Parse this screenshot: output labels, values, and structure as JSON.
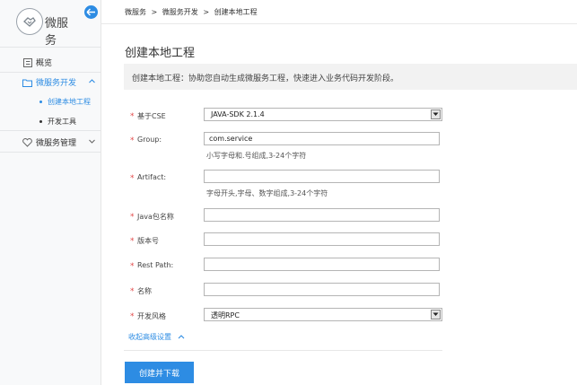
{
  "sidebar": {
    "app_title": "微服务",
    "items": [
      {
        "label": "概览",
        "icon": "list-icon"
      },
      {
        "label": "微服务开发",
        "icon": "folder-icon",
        "active": true,
        "children": [
          {
            "label": "创建本地工程",
            "active": true
          },
          {
            "label": "开发工具"
          }
        ]
      },
      {
        "label": "微服务管理",
        "icon": "heart-icon"
      }
    ]
  },
  "breadcrumb": [
    "微服务",
    ">",
    "微服务开发",
    ">",
    "创建本地工程"
  ],
  "page_title": "创建本地工程",
  "info_text": "创建本地工程：协助您自动生成微服务工程，快速进入业务代码开发阶段。",
  "form": {
    "base_cse": {
      "label": "基于CSE",
      "value": "JAVA-SDK 2.1.4"
    },
    "group": {
      "label": "Group:",
      "value": "com.service",
      "hint": "小写字母和.号组成,3-24个字符"
    },
    "artifact": {
      "label": "Artifact:",
      "value": "",
      "hint": "字母开头,字母、数字组成,3-24个字符"
    },
    "java_package": {
      "label": "Java包名称",
      "value": ""
    },
    "version": {
      "label": "版本号",
      "value": ""
    },
    "rest_path": {
      "label": "Rest Path:",
      "value": ""
    },
    "name": {
      "label": "名称",
      "value": ""
    },
    "dev_style": {
      "label": "开发风格",
      "value": "透明RPC"
    }
  },
  "required_mark": "*",
  "advanced_toggle": "收起高级设置",
  "submit_label": "创建并下载",
  "colors": {
    "accent": "#2d8ce3",
    "required": "#e24a4a",
    "info_bg": "#f2f2f2"
  }
}
